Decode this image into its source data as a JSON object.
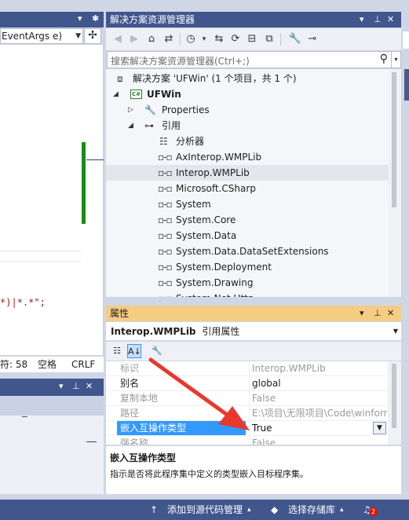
{
  "editor": {
    "member_combo": "EventArgs e)",
    "code_fragment": "*)|*.*\";",
    "status": {
      "char": "符: 58",
      "space": "空格",
      "eol": "CRLF"
    }
  },
  "solution_explorer": {
    "title": "解决方案资源管理器",
    "search_placeholder": "搜索解决方案资源管理器(Ctrl+;)",
    "tree": {
      "solution": "解决方案 'UFWin' (1 个项目，共 1 个)",
      "project": "UFWin",
      "properties": "Properties",
      "references": "引用",
      "analyzers": "分析器",
      "refs": [
        "AxInterop.WMPLib",
        "Interop.WMPLib",
        "Microsoft.CSharp",
        "System",
        "System.Core",
        "System.Data",
        "System.Data.DataSetExtensions",
        "System.Deployment",
        "System.Drawing",
        "System.Net.Http"
      ]
    }
  },
  "properties": {
    "title": "属性",
    "object_name": "Interop.WMPLib",
    "object_type": "引用属性",
    "rows": [
      {
        "name": "标识",
        "value": "Interop.WMPLib"
      },
      {
        "name": "别名",
        "value": "global"
      },
      {
        "name": "复制本地",
        "value": "False"
      },
      {
        "name": "路径",
        "value": "E:\\项目\\无限项目\\Code\\winform"
      },
      {
        "name": "嵌入互操作类型",
        "value": "True"
      },
      {
        "name": "强名称",
        "value": "False"
      }
    ],
    "description_title": "嵌入互操作类型",
    "description_body": "指示是否将此程序集中定义的类型嵌入目标程序集。"
  },
  "statusbar": {
    "source_control": "添加到源代码管理",
    "repository": "选择存储库",
    "notifications": "2"
  },
  "colors": {
    "title_bar": "#40568d",
    "active_title": "#f5cc84",
    "selection": "#3399ff",
    "annotation_arrow": "#e8382e"
  }
}
